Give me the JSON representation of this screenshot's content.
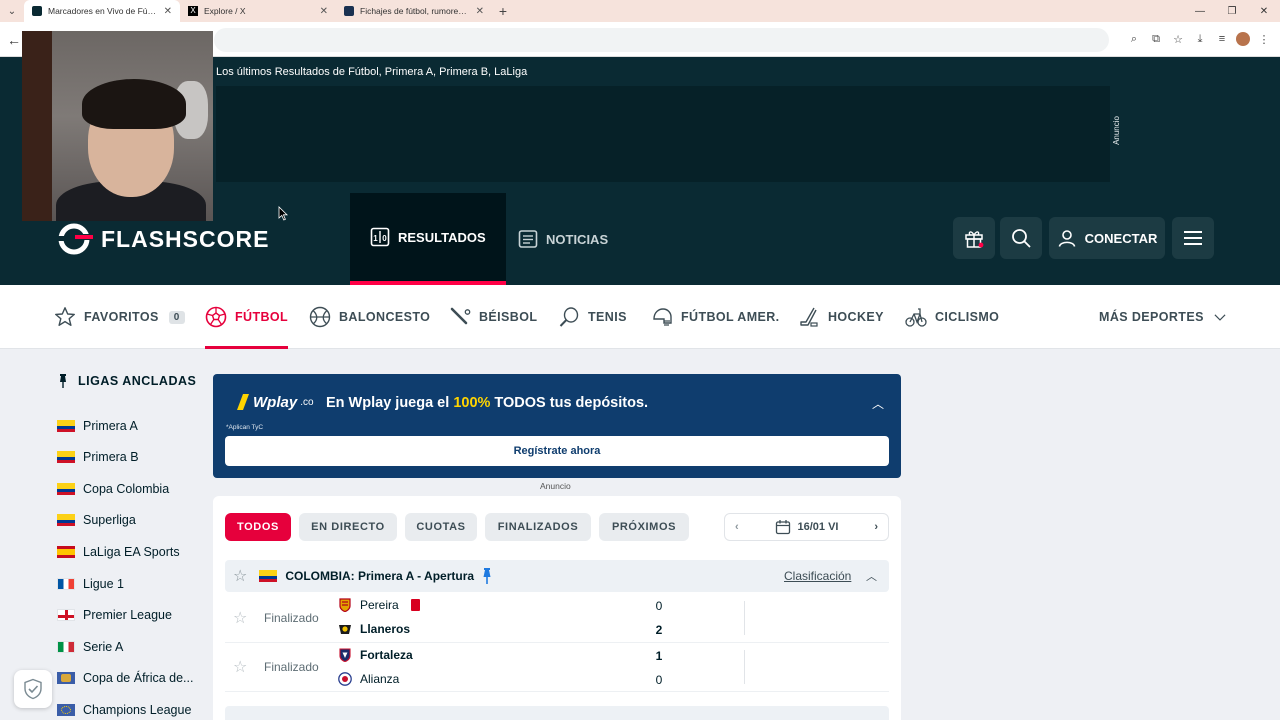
{
  "browser": {
    "tabs": [
      {
        "title": "Marcadores en Vivo de Fútbol,",
        "active": true
      },
      {
        "title": "Explore / X",
        "active": false
      },
      {
        "title": "Fichajes de fútbol, rumores, val",
        "active": false
      }
    ],
    "url": ""
  },
  "header": {
    "subtitle": "Los últimos Resultados de Fútbol, Primera A, Primera B, LaLiga",
    "ad_label_vertical": "Anuncio",
    "logo_text": "FLASHSCORE",
    "tabs": {
      "resultados": "RESULTADOS",
      "noticias": "NOTICIAS"
    },
    "connect_label": "CONECTAR"
  },
  "sports": {
    "favoritos": "FAVORITOS",
    "favoritos_count": "0",
    "futbol": "FÚTBOL",
    "baloncesto": "BALONCESTO",
    "beisbol": "BÉISBOL",
    "tenis": "TENIS",
    "futbol_amer": "FÚTBOL AMER.",
    "hockey": "HOCKEY",
    "ciclismo": "CICLISMO",
    "mas": "MÁS DEPORTES"
  },
  "sidebar": {
    "title": "LIGAS ANCLADAS",
    "leagues": [
      {
        "name": "Primera A",
        "flag": "colombia"
      },
      {
        "name": "Primera B",
        "flag": "colombia"
      },
      {
        "name": "Copa Colombia",
        "flag": "colombia"
      },
      {
        "name": "Superliga",
        "flag": "colombia"
      },
      {
        "name": "LaLiga EA Sports",
        "flag": "spain"
      },
      {
        "name": "Ligue 1",
        "flag": "france"
      },
      {
        "name": "Premier League",
        "flag": "england"
      },
      {
        "name": "Serie A",
        "flag": "italy"
      },
      {
        "name": "Copa de África de...",
        "flag": "africa"
      },
      {
        "name": "Champions League",
        "flag": "europe"
      }
    ]
  },
  "promo": {
    "logo": "Wplay",
    "logo_suffix": ".co",
    "text_before": "En Wplay juega el ",
    "text_highlight": "100%",
    "text_after": " TODOS tus depósitos.",
    "terms": "*Aplican TyC",
    "button": "Regístrate ahora",
    "ad_label": "Anuncio"
  },
  "filters": {
    "todos": "TODOS",
    "directo": "EN DIRECTO",
    "cuotas": "CUOTAS",
    "finalizados": "FINALIZADOS",
    "proximos": "PRÓXIMOS",
    "date": "16/01 VI"
  },
  "league_block": {
    "title": "COLOMBIA: Primera A - Apertura",
    "standings_link": "Clasificación"
  },
  "matches": [
    {
      "status": "Finalizado",
      "home": "Pereira",
      "away": "Llaneros",
      "home_score": "0",
      "away_score": "2",
      "home_red_cards": 1
    },
    {
      "status": "Finalizado",
      "home": "Fortaleza",
      "away": "Alianza",
      "home_score": "1",
      "away_score": "0",
      "home_red_cards": 0
    }
  ],
  "colors": {
    "brand_dark": "#0a2a33",
    "accent": "#e6003c",
    "promo_blue": "#0f3d6e",
    "promo_highlight": "#ffd400"
  }
}
